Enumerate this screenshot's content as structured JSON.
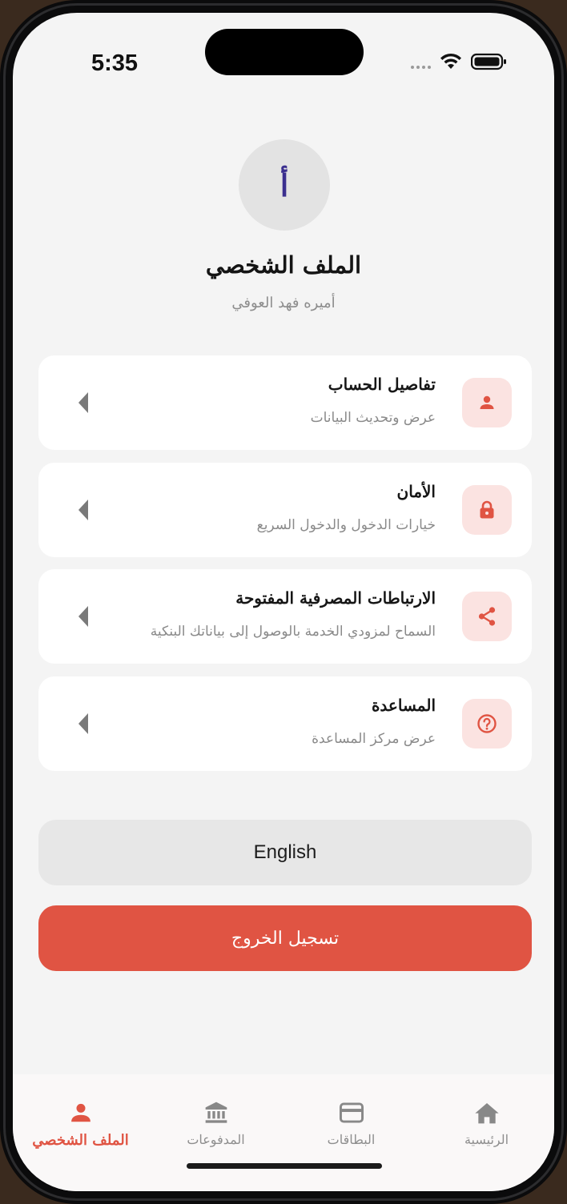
{
  "status_bar": {
    "time": "5:35"
  },
  "profile": {
    "avatar_initial": "أ",
    "title": "الملف الشخصي",
    "user_name": "أميره فهد العوفي"
  },
  "menu": {
    "items": [
      {
        "title": "تفاصيل الحساب",
        "subtitle": "عرض وتحديث البيانات",
        "icon": "person-icon"
      },
      {
        "title": "الأمان",
        "subtitle": "خيارات الدخول والدخول السريع",
        "icon": "lock-icon"
      },
      {
        "title": "الارتباطات المصرفية المفتوحة",
        "subtitle": "السماح لمزودي الخدمة بالوصول إلى بياناتك البنكية",
        "icon": "share-icon"
      },
      {
        "title": "المساعدة",
        "subtitle": "عرض مركز المساعدة",
        "icon": "help-icon"
      }
    ]
  },
  "actions": {
    "language_label": "English",
    "logout_label": "تسجيل الخروج"
  },
  "tabs": [
    {
      "label": "الملف الشخصي",
      "icon": "person-icon",
      "active": true
    },
    {
      "label": "المدفوعات",
      "icon": "bank-icon",
      "active": false
    },
    {
      "label": "البطاقات",
      "icon": "card-icon",
      "active": false
    },
    {
      "label": "الرئيسية",
      "icon": "home-icon",
      "active": false
    }
  ],
  "colors": {
    "accent": "#e05443",
    "icon_bg": "#fbe3e1",
    "background": "#f4f4f4"
  }
}
